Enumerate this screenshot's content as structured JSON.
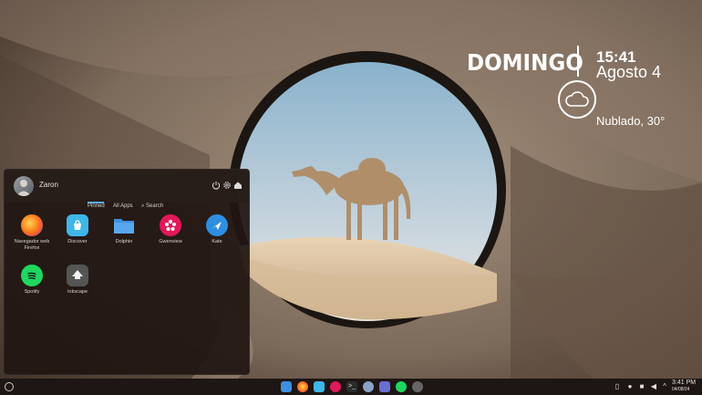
{
  "widget": {
    "day": "DOMINGO",
    "time": "15:41",
    "date": "Agosto 4",
    "weather": "Nublado, 30°",
    "weather_icon": "cloud-icon"
  },
  "launcher": {
    "username": "Zaron",
    "tabs": [
      "Pinned",
      "All Apps",
      "Search"
    ],
    "active_tab": "Pinned",
    "apps": [
      {
        "label": "Navegador web Firefox",
        "line1": "Navegador web",
        "line2": "Firefox",
        "icon": "firefox-icon",
        "color": "#ff6d1a"
      },
      {
        "label": "Discover",
        "icon": "discover-icon",
        "color": "#3fb6e8"
      },
      {
        "label": "Dolphin",
        "icon": "folder-icon",
        "color": "#3d8fe0"
      },
      {
        "label": "Gwenview",
        "icon": "gwenview-icon",
        "color": "#e0195a"
      },
      {
        "label": "Kate",
        "icon": "kate-icon",
        "color": "#2e8fe2"
      },
      {
        "label": "Spotify",
        "icon": "spotify-icon",
        "color": "#1ed760"
      },
      {
        "label": "Inkscape",
        "icon": "inkscape-icon",
        "color": "#555555"
      }
    ]
  },
  "taskbar": {
    "time": "3:41 PM",
    "date": "04/08/24"
  }
}
